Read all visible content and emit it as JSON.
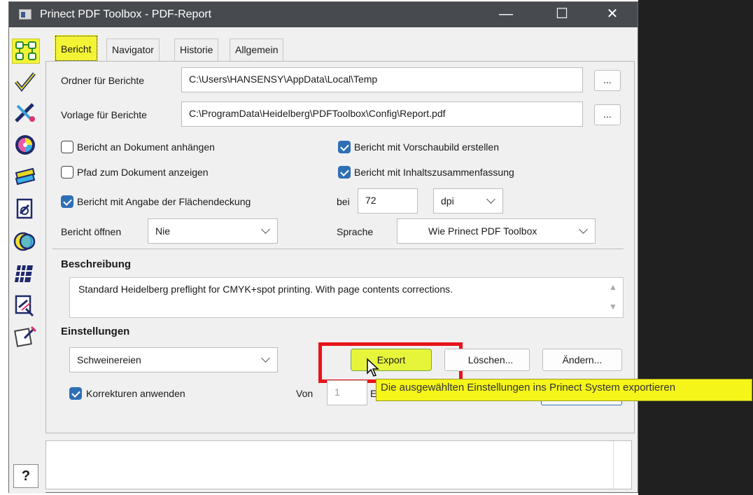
{
  "window": {
    "title": "Prinect PDF Toolbox - PDF-Report",
    "minimize_glyph": "—",
    "maximize_glyph": "☐",
    "close_glyph": "✕"
  },
  "sidebar": {
    "icons": [
      "profiles-icon",
      "check-icon",
      "fix-icon",
      "color-icon",
      "swatch-icon",
      "document-icon",
      "ink-icon",
      "grid-icon",
      "inspect-icon",
      "edit-icon"
    ],
    "help_label": "?"
  },
  "tabs": [
    {
      "label": "Bericht",
      "active": true
    },
    {
      "label": "Navigator",
      "active": false
    },
    {
      "label": "Historie",
      "active": false
    },
    {
      "label": "Allgemein",
      "active": false
    }
  ],
  "report": {
    "folder_label": "Ordner für Berichte",
    "folder_value": "C:\\Users\\HANSENSY\\AppData\\Local\\Temp",
    "folder_browse": "...",
    "template_label": "Vorlage für Berichte",
    "template_value": "C:\\ProgramData\\Heidelberg\\PDFToolbox\\Config\\Report.pdf",
    "template_browse": "...",
    "attach_label": "Bericht an Dokument anhängen",
    "preview_label": "Bericht mit Vorschaubild erstellen",
    "path_label": "Pfad zum Dokument anzeigen",
    "summary_label": "Bericht mit Inhaltszusammenfassung",
    "coverage_label": "Bericht mit Angabe der Flächendeckung",
    "bei_label": "bei",
    "dpi_value": "72",
    "dpi_unit": "dpi",
    "open_label": "Bericht öffnen",
    "open_value": "Nie",
    "language_label": "Sprache",
    "language_value": "Wie Prinect PDF Toolbox"
  },
  "description": {
    "heading": "Beschreibung",
    "text": "Standard Heidelberg preflight for CMYK+spot printing. With page contents corrections."
  },
  "settings": {
    "heading": "Einstellungen",
    "selected": "Schweinereien",
    "export_label": "Export",
    "delete_label": "Löschen...",
    "edit_label": "Ändern...",
    "corrections_label": "Korrekturen anwenden",
    "von_label": "Von",
    "von_value": "1",
    "bis_partial": "E"
  },
  "tooltip": {
    "text": "Die ausgewählten Einstellungen ins Prinect System exportieren"
  },
  "colors": {
    "highlight": "#f3f335",
    "titlebar": "#474a4f",
    "checkbox": "#2f6fb5",
    "annotation": "#e8141a"
  }
}
